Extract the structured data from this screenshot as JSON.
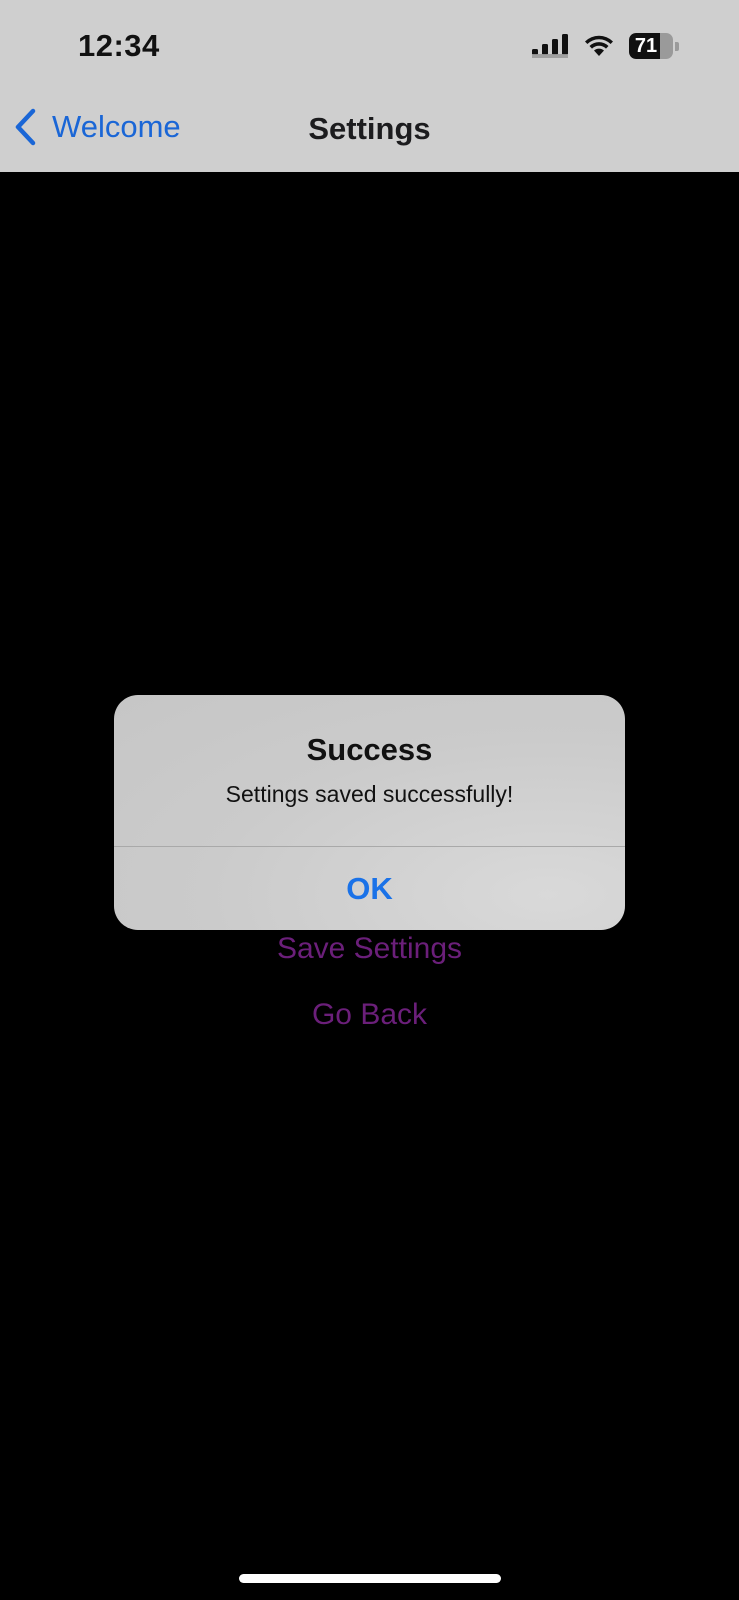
{
  "status_bar": {
    "time": "12:34",
    "battery_level": "71",
    "battery_fraction": 0.71,
    "signal_icon": "cellular-signal-icon",
    "wifi_icon": "wifi-icon",
    "battery_icon": "battery-icon"
  },
  "nav_bar": {
    "back_label": "Welcome",
    "back_icon": "chevron-left-icon",
    "title": "Settings"
  },
  "content": {
    "save_settings_label": "Save Settings",
    "go_back_label": "Go Back"
  },
  "alert": {
    "title": "Success",
    "message": "Settings saved successfully!",
    "ok_label": "OK"
  },
  "colors": {
    "header_background": "#cfcfcf",
    "screen_background": "#000000",
    "link_blue": "#1a66d6",
    "alert_button_blue": "#1a72e8",
    "content_link_purple": "#6b1f7a"
  }
}
